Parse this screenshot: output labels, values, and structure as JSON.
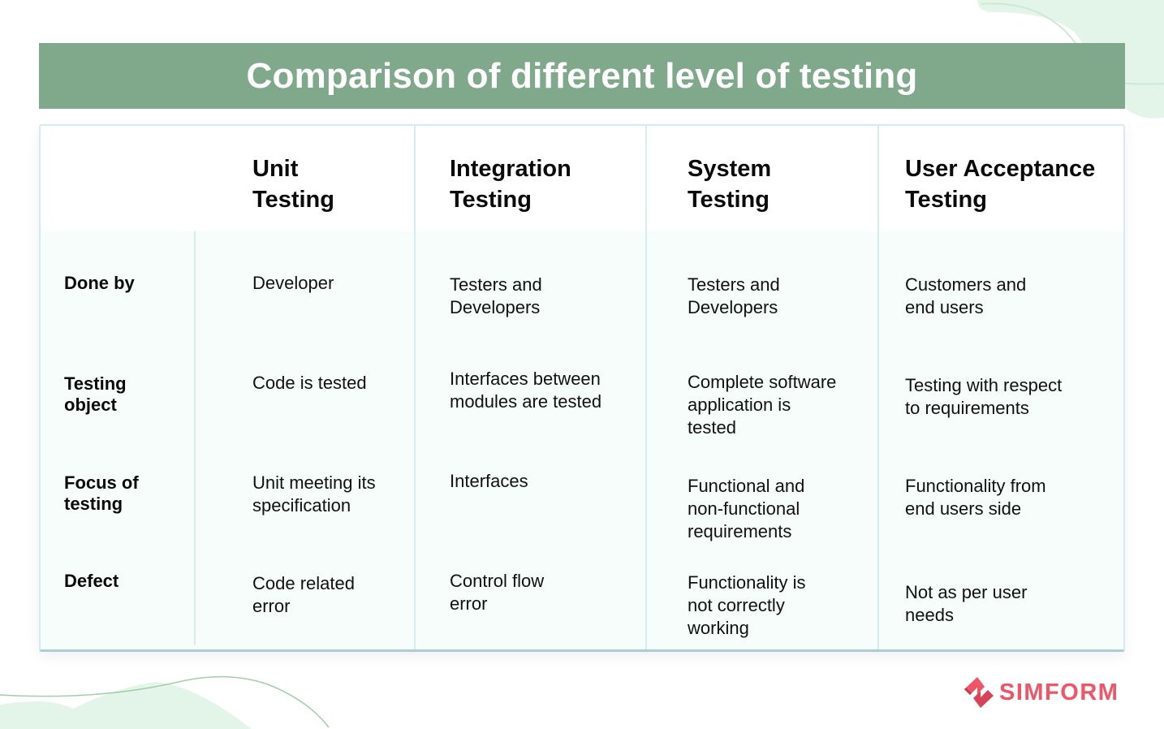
{
  "title": "Comparison of different level of testing",
  "columns": [
    {
      "line1": "Unit",
      "line2": "Testing"
    },
    {
      "line1": "Integration",
      "line2": "Testing"
    },
    {
      "line1": "System",
      "line2": "Testing"
    },
    {
      "line1": "User Acceptance",
      "line2": "Testing"
    }
  ],
  "rows": [
    {
      "label": "Done by",
      "cells": [
        "Developer",
        "Testers and\nDevelopers",
        "Testers and\nDevelopers",
        "Customers and\nend users"
      ]
    },
    {
      "label": "Testing\nobject",
      "cells": [
        "Code is tested",
        "Interfaces between\nmodules are tested",
        "Complete software\napplication is\ntested",
        "Testing with respect\nto requirements"
      ]
    },
    {
      "label": "Focus of\ntesting",
      "cells": [
        "Unit meeting its\nspecification",
        "Interfaces",
        "Functional and\nnon-functional\nrequirements",
        "Functionality from\nend users side"
      ]
    },
    {
      "label": "Defect",
      "cells": [
        "Code related\nerror",
        "Control flow\nerror",
        "Functionality is\nnot correctly\nworking",
        "Not as per user\nneeds"
      ]
    }
  ],
  "brand": {
    "name": "SIMFORM",
    "color": "#ee5567"
  },
  "colors": {
    "title_bar": "#80a98c",
    "table_body": "#f6fdfa",
    "divider": "#d6ecec"
  }
}
